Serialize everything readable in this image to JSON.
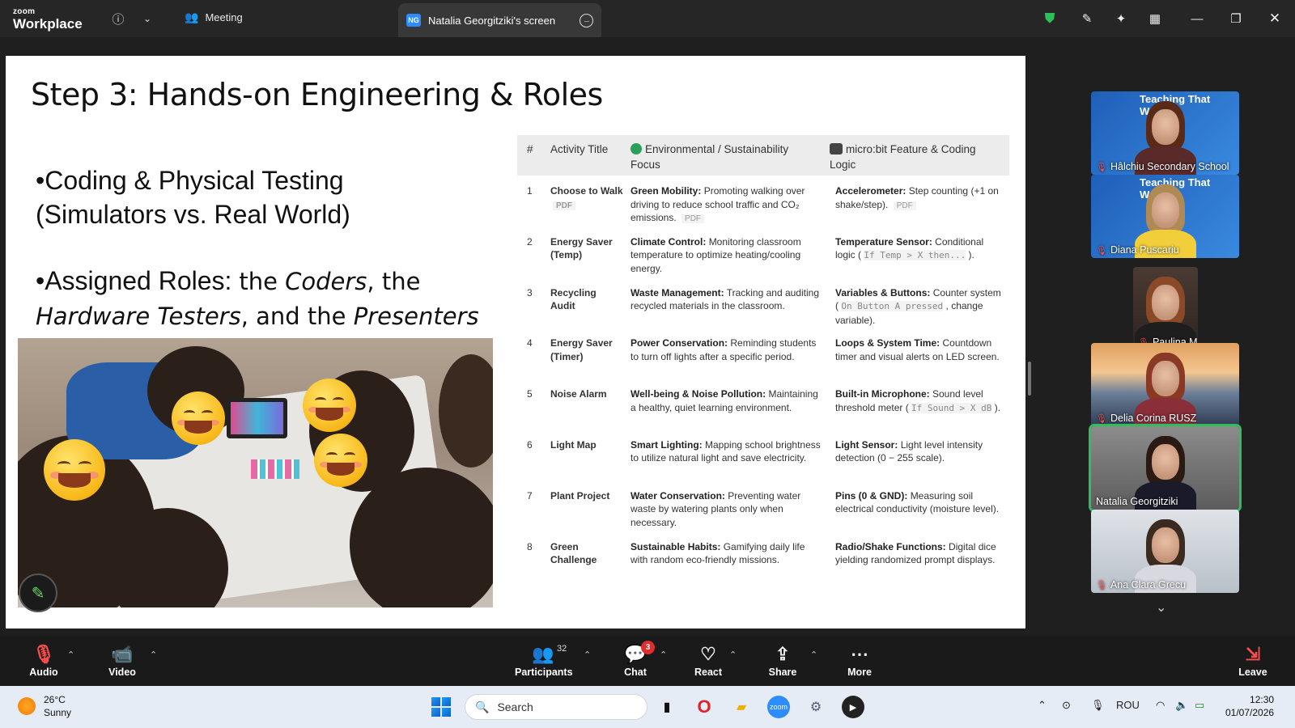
{
  "titlebar": {
    "brand_small": "zoom",
    "brand_main": "Workplace",
    "meeting_label": "Meeting",
    "screen_tab_label": "Natalia Georgitziki's screen",
    "screen_tab_initials": "NG",
    "icons": [
      "info-icon",
      "chevron-down-icon",
      "meeting-icon",
      "more-options-icon",
      "shield-icon",
      "annotate-icon",
      "ai-companion-icon",
      "layout-icon",
      "minimize-icon",
      "restore-icon",
      "close-icon"
    ],
    "shield_color": "#2fbf5a"
  },
  "slide": {
    "title": "Step 3: Hands-on Engineering & Roles",
    "bullet1_line1": "•Coding & Physical Testing",
    "bullet1_line2": "(Simulators vs. Real World)",
    "bullet2_prefix": "•Assigned Roles:",
    "bullet2_a": "the",
    "role1": "Coders",
    "bullet2_b": ", the",
    "role2": "Hardware Testers",
    "bullet2_c": ", and the",
    "role3": "Presenters",
    "table": {
      "headers": [
        "#",
        "Activity Title",
        "Environmental / Sustainability Focus",
        "micro:bit Feature & Coding Logic"
      ],
      "rows": [
        {
          "n": "1",
          "title": "Choose to Walk",
          "title_tag": "PDF",
          "focus_label": "Green Mobility:",
          "focus_text": "Promoting walking over driving to reduce school traffic and CO₂ emissions.",
          "focus_tag": "PDF",
          "feature_label": "Accelerometer:",
          "feature_text": "Step counting (+1 on shake/step).",
          "feature_code": "",
          "feature_tail": "",
          "feature_tag": "PDF"
        },
        {
          "n": "2",
          "title": "Energy Saver (Temp)",
          "title_tag": "",
          "focus_label": "Climate Control:",
          "focus_text": "Monitoring classroom temperature to optimize heating/cooling energy.",
          "focus_tag": "",
          "feature_label": "Temperature Sensor:",
          "feature_text": "Conditional logic (",
          "feature_code": "If Temp > X then...",
          "feature_tail": ").",
          "feature_tag": ""
        },
        {
          "n": "3",
          "title": "Recycling Audit",
          "title_tag": "",
          "focus_label": "Waste Management:",
          "focus_text": "Tracking and auditing recycled materials in the classroom.",
          "focus_tag": "",
          "feature_label": "Variables & Buttons:",
          "feature_text": "Counter system (",
          "feature_code": "On Button A pressed",
          "feature_tail": ", change variable).",
          "feature_tag": ""
        },
        {
          "n": "4",
          "title": "Energy Saver (Timer)",
          "title_tag": "",
          "focus_label": "Power Conservation:",
          "focus_text": "Reminding students to turn off lights after a specific period.",
          "focus_tag": "",
          "feature_label": "Loops & System Time:",
          "feature_text": "Countdown timer and visual alerts on LED screen.",
          "feature_code": "",
          "feature_tail": "",
          "feature_tag": ""
        },
        {
          "n": "5",
          "title": "Noise Alarm",
          "title_tag": "",
          "focus_label": "Well-being & Noise Pollution:",
          "focus_text": "Maintaining a healthy, quiet learning environment.",
          "focus_tag": "",
          "feature_label": "Built-in Microphone:",
          "feature_text": "Sound level threshold meter (",
          "feature_code": "If Sound > X dB",
          "feature_tail": ").",
          "feature_tag": ""
        },
        {
          "n": "6",
          "title": "Light Map",
          "title_tag": "",
          "focus_label": "Smart Lighting:",
          "focus_text": "Mapping school brightness to utilize natural light and save electricity.",
          "focus_tag": "",
          "feature_label": "Light Sensor:",
          "feature_text": "Light level intensity detection (0 − 255 scale).",
          "feature_code": "",
          "feature_tail": "",
          "feature_tag": ""
        },
        {
          "n": "7",
          "title": "Plant Project",
          "title_tag": "",
          "focus_label": "Water Conservation:",
          "focus_text": "Preventing water waste by watering plants only when necessary.",
          "focus_tag": "",
          "feature_label": "Pins (0 & GND):",
          "feature_text": "Measuring soil electrical conductivity (moisture level).",
          "feature_code": "",
          "feature_tail": "",
          "feature_tag": ""
        },
        {
          "n": "8",
          "title": "Green Challenge",
          "title_tag": "",
          "focus_label": "Sustainable Habits:",
          "focus_text": "Gamifying daily life with random eco-friendly missions.",
          "focus_tag": "",
          "feature_label": "Radio/Shake Functions:",
          "feature_text": "Digital dice yielding randomized prompt displays.",
          "feature_code": "",
          "feature_tail": "",
          "feature_tag": ""
        }
      ]
    }
  },
  "gallery": {
    "participants": [
      {
        "name": "Hâlchiu Secondary School",
        "muted": true,
        "banner": "Teaching That Works"
      },
      {
        "name": "Diana Puscariu",
        "muted": true,
        "banner": "Teaching That Works"
      },
      {
        "name": "Paulina Majdzińska KPCE...",
        "muted": true,
        "banner": ""
      },
      {
        "name": "Delia Corina RUSZ",
        "muted": true,
        "banner": ""
      },
      {
        "name": "Natalia Georgitziki",
        "muted": false,
        "banner": "",
        "active_speaker": true
      },
      {
        "name": "Ana Clara Grecu",
        "muted": true,
        "banner": ""
      }
    ],
    "active_color": "#2fbf5a"
  },
  "toolbar": {
    "audio": "Audio",
    "video": "Video",
    "participants": "Participants",
    "participants_count": "32",
    "chat": "Chat",
    "chat_badge": "3",
    "react": "React",
    "share": "Share",
    "more": "More",
    "leave": "Leave"
  },
  "taskbar": {
    "temperature": "26°C",
    "condition": "Sunny",
    "search_placeholder": "Search",
    "language": "ROU",
    "time": "12:30",
    "date": "01/07/2026"
  }
}
